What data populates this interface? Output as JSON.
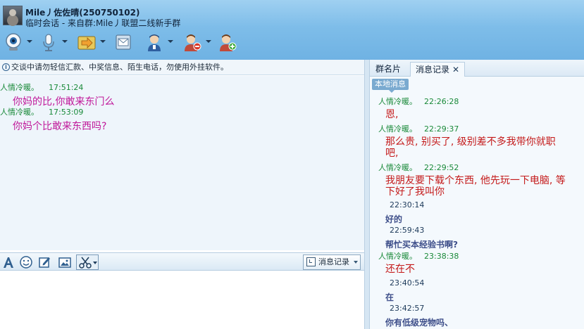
{
  "header": {
    "contact_name": "Mile丿佐佐晴(250750102)",
    "contact_sub": "临时会话 - 来自群:Mile丿联盟二线新手群"
  },
  "toolbar": {
    "icons": [
      "webcam-icon",
      "microphone-icon",
      "file-transfer-icon",
      "mail-icon",
      "remote-assist-icon",
      "block-user-icon",
      "add-friend-icon"
    ]
  },
  "notice": "交谈中请勿轻信汇款、中奖信息、陌生电话，勿使用外挂软件。",
  "chat": {
    "messages": [
      {
        "sender": "人情冷暖。",
        "time": "17:51:24",
        "text": "你妈的比,你敢来东门么"
      },
      {
        "sender": "人情冷暖。",
        "time": "17:53:09",
        "text": "你妈个比敢来东西吗?"
      }
    ]
  },
  "inputbar": {
    "history_label": "消息记录",
    "icons": [
      "font-icon",
      "emoji-icon",
      "edit-icon",
      "image-icon",
      "scissors-icon"
    ]
  },
  "right": {
    "tab_card": "群名片",
    "tab_history": "消息记录",
    "tab_close": "✕",
    "local_tag": "本地消息",
    "entries": [
      {
        "type": "other",
        "sender": "人情冷暖。",
        "time": "22:26:28",
        "text": "恩,"
      },
      {
        "type": "other",
        "sender": "人情冷暖。",
        "time": "22:29:37",
        "text": "那么贵, 别买了, 级别差不多我带你就职吧,"
      },
      {
        "type": "other",
        "sender": "人情冷暖。",
        "time": "22:29:52",
        "text": "我朋友要下载个东西, 他先玩一下电脑, 等下好了我叫你"
      },
      {
        "type": "own",
        "time": "22:30:14",
        "text": "好的"
      },
      {
        "type": "own",
        "time": "22:59:43",
        "text": "帮忙买本经验书啊?"
      },
      {
        "type": "other",
        "sender": "人情冷暖。",
        "time": "23:38:38",
        "text": "还在不"
      },
      {
        "type": "own",
        "time": "23:40:54",
        "text": "在"
      },
      {
        "type": "own",
        "time": "23:42:57",
        "text": "你有低级宠物吗、"
      }
    ]
  },
  "colors": {
    "header_top": "#9fd0f1",
    "sender_green": "#1a8a3a",
    "chat_magenta": "#c0189a",
    "history_red": "#c41a1a",
    "own_blue": "#3e4f8a"
  }
}
